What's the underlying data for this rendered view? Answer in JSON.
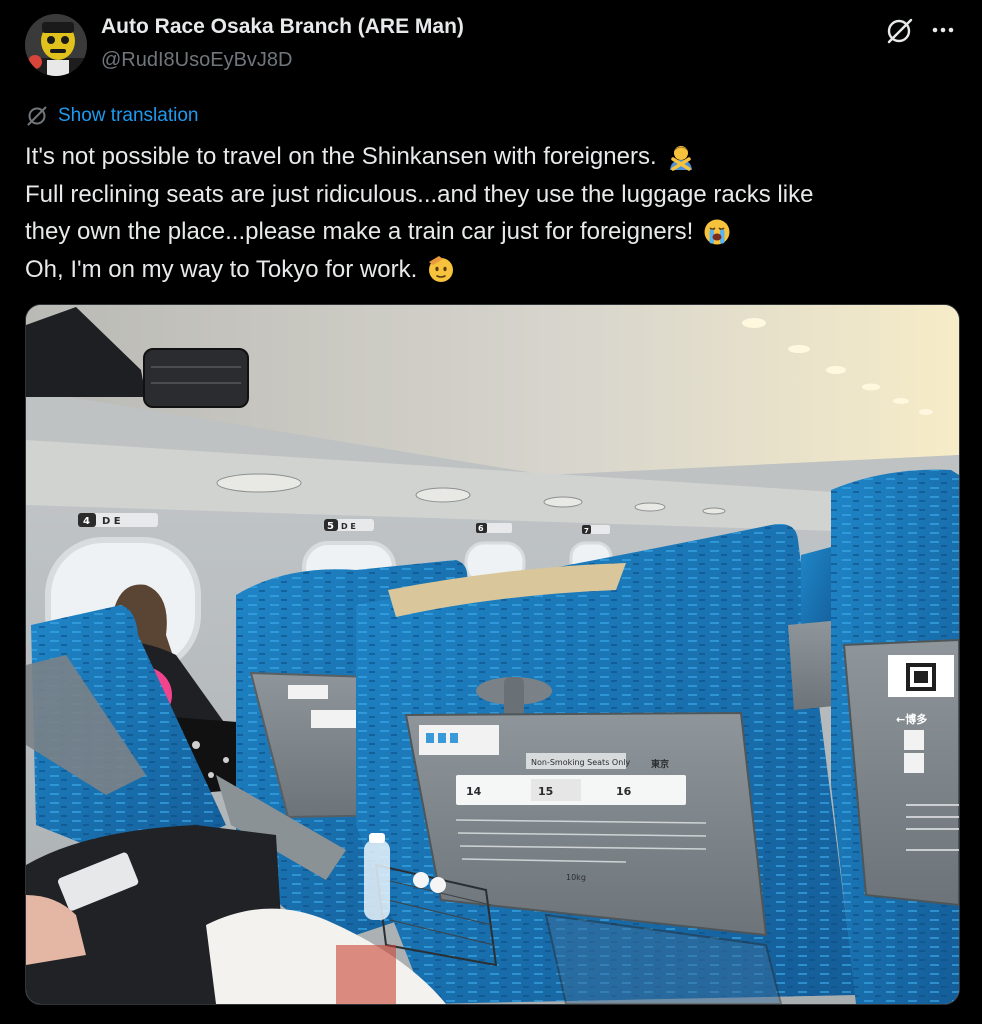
{
  "author": {
    "display_name": "Auto Race Osaka Branch (ARE Man)",
    "handle": "@RudI8UsoEyBvJ8D",
    "avatar_icon": "avatar-mascot-icon"
  },
  "header_actions": {
    "grok_icon": "grok-icon",
    "more_icon": "more-icon"
  },
  "translation": {
    "label": "Show translation",
    "icon": "translate-icon"
  },
  "tweet": {
    "lines": [
      "It's not possible to travel on the Shinkansen with foreigners.",
      "Full reclining seats are just ridiculous...and they use the luggage racks like",
      "they own the place...please make a train car just for foreigners!",
      "Oh, I'm on my way to Tokyo for work."
    ],
    "emojis": [
      "person-gesturing-no-emoji",
      "loudly-crying-face-emoji",
      "saluting-face-emoji"
    ]
  },
  "media": {
    "seat_numbers": [
      "4",
      "5",
      "6",
      "7"
    ],
    "seat_letters": "D E",
    "tray_table": {
      "no_smoking": "Non-Smoking Seats Only",
      "destination_tokyo": "東京",
      "destination_hakata": "←博多",
      "cars": [
        "14",
        "15",
        "16"
      ],
      "weight_limit": "10kg"
    }
  },
  "colors": {
    "background": "#000000",
    "text_primary": "#e7e9ea",
    "text_secondary": "#71767b",
    "link": "#1d9bf0",
    "seat_blue": "#1c73b4"
  }
}
